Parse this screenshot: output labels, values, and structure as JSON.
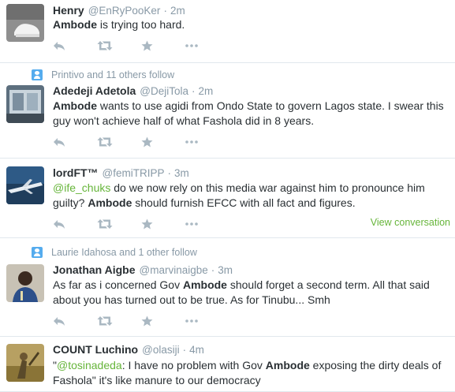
{
  "tweets": [
    {
      "context": "",
      "fullname": "Henry",
      "username": "@EnRyPooKer",
      "separator": "·",
      "time": "2m",
      "segments": [
        {
          "t": "Ambode",
          "b": true
        },
        {
          "t": " is trying too hard."
        }
      ],
      "view_conversation": ""
    },
    {
      "context": "Printivo and 11 others follow",
      "fullname": "Adedeji Adetola",
      "username": "@DejiTola",
      "separator": "·",
      "time": "2m",
      "segments": [
        {
          "t": "Ambode",
          "b": true
        },
        {
          "t": " wants to use agidi from Ondo State to govern Lagos state. I swear this guy won't achieve half of what Fashola did in 8 years."
        }
      ],
      "view_conversation": ""
    },
    {
      "context": "",
      "fullname": "lordFT™",
      "username": "@femiTRIPP",
      "separator": "·",
      "time": "3m",
      "segments": [
        {
          "t": "@ife_chuks",
          "m": true
        },
        {
          "t": " do we now rely on this media war against him to pronounce him guilty? "
        },
        {
          "t": "Ambode",
          "b": true
        },
        {
          "t": " should furnish EFCC with all fact and figures."
        }
      ],
      "view_conversation": "View conversation"
    },
    {
      "context": "Laurie Idahosa and 1 other follow",
      "fullname": "Jonathan Aigbe",
      "username": "@marvinaigbe",
      "separator": "·",
      "time": "3m",
      "segments": [
        {
          "t": "As far as i concerned Gov "
        },
        {
          "t": "Ambode",
          "b": true
        },
        {
          "t": " should forget a second term. All that said about you has turned out to be true. As for Tinubu... Smh"
        }
      ],
      "view_conversation": ""
    },
    {
      "context": "",
      "fullname": "COUNT Luchino",
      "username": "@olasiji",
      "separator": "·",
      "time": "4m",
      "segments": [
        {
          "t": "\""
        },
        {
          "t": "@tosinadeda",
          "m": true
        },
        {
          "t": ": I have no problem with Gov "
        },
        {
          "t": "Ambode",
          "b": true
        },
        {
          "t": " exposing the dirty deals of Fashola\" it's like manure to our democracy"
        }
      ],
      "view_conversation": ""
    }
  ],
  "action_icons": [
    "reply-icon",
    "retweet-icon",
    "favorite-icon",
    "more-icon"
  ],
  "colors": {
    "meta": "#8899a6",
    "text": "#292f33",
    "mention": "#66b53a",
    "icon": "#aab8c2",
    "context_icon": "#55acee",
    "divider": "#e1e8ed"
  }
}
